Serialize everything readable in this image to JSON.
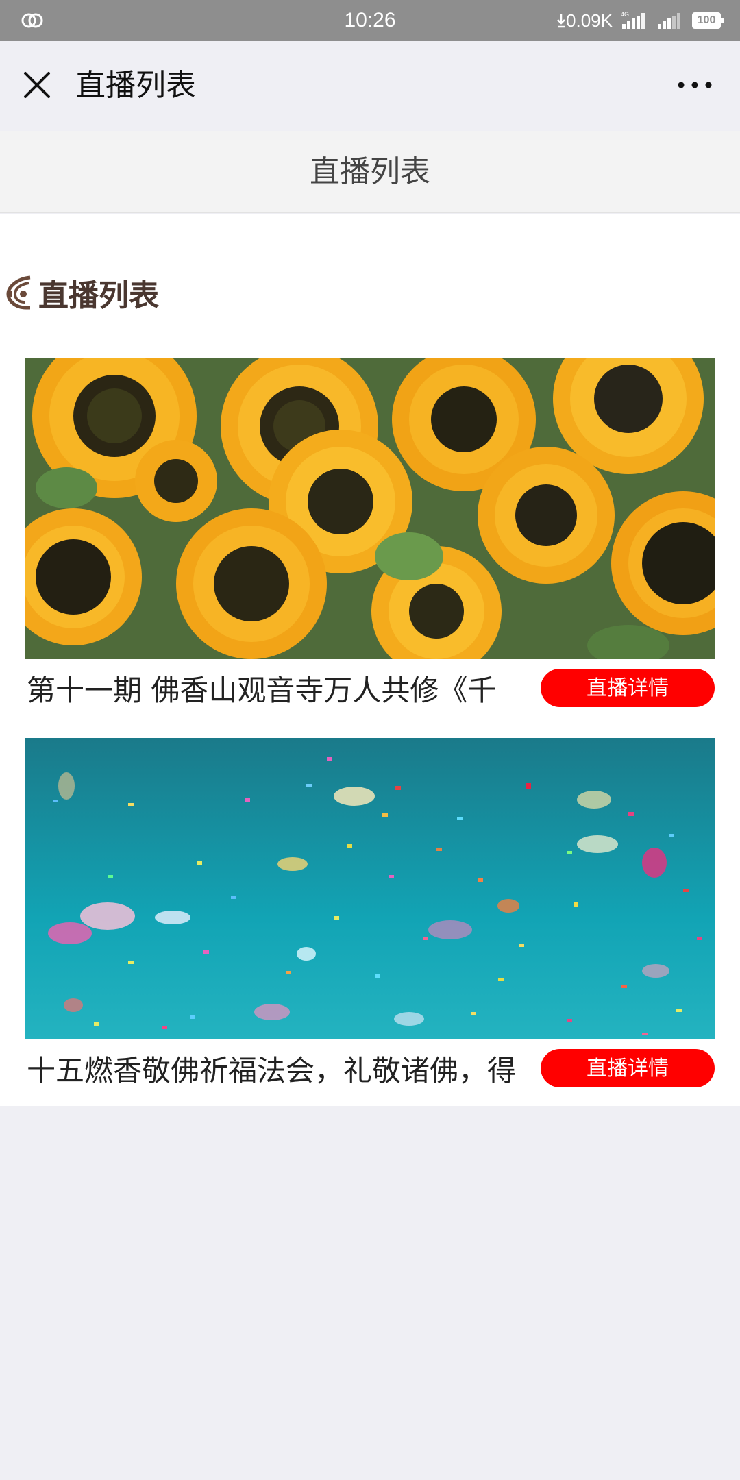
{
  "status_bar": {
    "time": "10:26",
    "network_speed": "0.09K",
    "network_type": "4G",
    "battery": "100"
  },
  "nav": {
    "title": "直播列表"
  },
  "sub_header": {
    "title": "直播列表"
  },
  "section": {
    "title": "直播列表"
  },
  "live_items": [
    {
      "title": "第十一期 佛香山观音寺万人共修《千",
      "button_label": "直播详情",
      "image": "sunflowers"
    },
    {
      "title": "十五燃香敬佛祈福法会，礼敬诸佛，得",
      "button_label": "直播详情",
      "image": "confetti-teal"
    }
  ],
  "colors": {
    "status_bar": "#8e8e8e",
    "button": "#ff0000",
    "section_title": "#4a3730",
    "page_bg": "#efeff4"
  }
}
